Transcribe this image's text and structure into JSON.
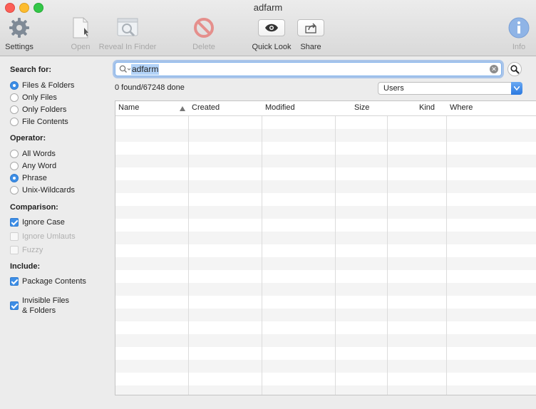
{
  "window": {
    "title": "adfarm"
  },
  "toolbar": {
    "settings": "Settings",
    "open": "Open",
    "reveal": "Reveal In Finder",
    "delete": "Delete",
    "quicklook": "Quick Look",
    "share": "Share",
    "info": "Info"
  },
  "sidebar": {
    "search_for": {
      "title": "Search for:",
      "options": [
        "Files & Folders",
        "Only Files",
        "Only Folders",
        "File Contents"
      ],
      "selected": 0
    },
    "operator": {
      "title": "Operator:",
      "options": [
        "All Words",
        "Any Word",
        "Phrase",
        "Unix-Wildcards"
      ],
      "selected": 2
    },
    "comparison": {
      "title": "Comparison:",
      "ignore_case": "Ignore Case",
      "ignore_umlauts": "Ignore Umlauts",
      "fuzzy": "Fuzzy"
    },
    "include": {
      "title": "Include:",
      "package_contents": "Package Contents",
      "invisible_line1": "Invisible Files",
      "invisible_line2": "& Folders"
    }
  },
  "search": {
    "value": "adfarm",
    "status": "0 found/67248 done",
    "scope": "Users"
  },
  "table": {
    "columns": [
      "Name",
      "Created",
      "Modified",
      "Size",
      "Kind",
      "Where"
    ]
  }
}
